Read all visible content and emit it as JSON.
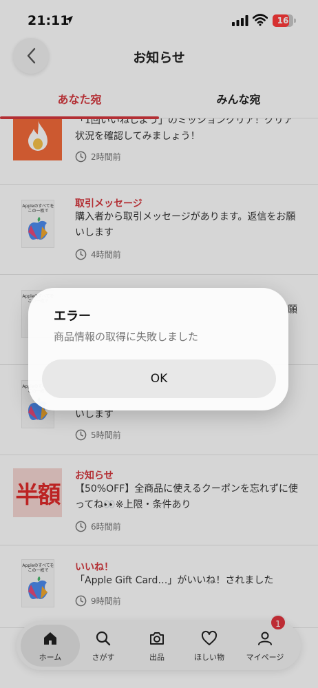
{
  "status_bar": {
    "time": "21:11",
    "battery": "16"
  },
  "header": {
    "title": "お知らせ"
  },
  "tabs": {
    "active": "あなた宛",
    "inactive": "みんな宛"
  },
  "notifications": [
    {
      "label": "",
      "body": "「1回いいねしよう」のミッションクリア！クリア状況を確認してみましょう！",
      "time": "2時間前",
      "thumb": "fire"
    },
    {
      "label": "取引メッセージ",
      "body": "購入者から取引メッセージがあります。返信をお願いします",
      "time": "4時間前",
      "thumb": "apple-card"
    },
    {
      "label": "",
      "body": "願",
      "time": "",
      "thumb": "apple-card"
    },
    {
      "label": "",
      "body": "いします",
      "time": "5時間前",
      "thumb": "apple-card"
    },
    {
      "label": "お知らせ",
      "body": "【50%OFF】全商品に使えるクーポンを忘れずに使ってね👀※上限・条件あり",
      "time": "6時間前",
      "thumb": "half"
    },
    {
      "label": "いいね！",
      "body": "「Apple Gift Card…」がいいね！されました",
      "time": "9時間前",
      "thumb": "apple-card"
    }
  ],
  "thumb_texts": {
    "apple_card_caption": "Appleのすべてを\nこの一枚で",
    "half": "半額"
  },
  "dialog": {
    "title": "エラー",
    "message": "商品情報の取得に失敗しました",
    "ok_label": "OK"
  },
  "tabbar": {
    "items": [
      {
        "label": "ホーム",
        "icon": "home-icon"
      },
      {
        "label": "さがす",
        "icon": "search-icon"
      },
      {
        "label": "出品",
        "icon": "camera-icon"
      },
      {
        "label": "ほしい物",
        "icon": "heart-icon"
      },
      {
        "label": "マイページ",
        "icon": "person-icon"
      }
    ],
    "mypage_badge": "1"
  },
  "colors": {
    "accent": "#d6383f",
    "badge": "#e2353f"
  }
}
